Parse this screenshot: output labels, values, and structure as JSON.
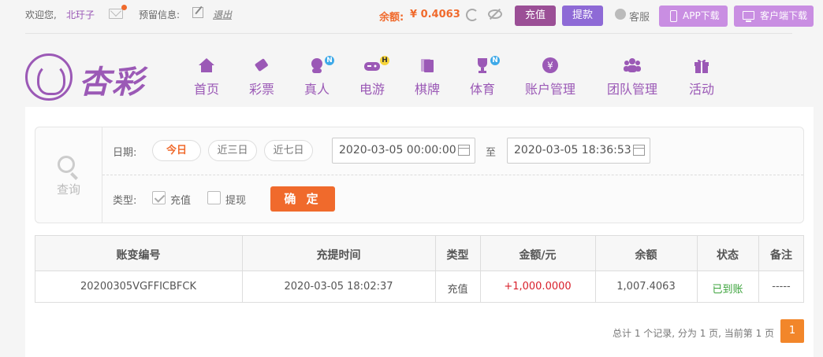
{
  "header": {
    "welcome": "欢迎您,",
    "username": "北玗子",
    "reserved_info_label": "预留信息:",
    "logout": "退出",
    "balance_label": "余额:",
    "balance_value": "¥ 0.4063",
    "recharge_label": "充值",
    "withdraw_label": "提款",
    "service_label": "客服",
    "app_download": "APP下载",
    "client_download": "客户端下载"
  },
  "logo": {
    "text": "杏彩"
  },
  "nav": {
    "items": [
      {
        "label": "首页",
        "icon": "home-icon",
        "badge": ""
      },
      {
        "label": "彩票",
        "icon": "lottery-ticket-icon",
        "badge": ""
      },
      {
        "label": "真人",
        "icon": "live-dealer-icon",
        "badge": "N"
      },
      {
        "label": "电游",
        "icon": "gamepad-icon",
        "badge": "H"
      },
      {
        "label": "棋牌",
        "icon": "cards-icon",
        "badge": ""
      },
      {
        "label": "体育",
        "icon": "trophy-icon",
        "badge": "N"
      },
      {
        "label": "账户管理",
        "icon": "account-yen-icon",
        "badge": ""
      },
      {
        "label": "团队管理",
        "icon": "team-icon",
        "badge": ""
      },
      {
        "label": "活动",
        "icon": "gift-icon",
        "badge": ""
      }
    ]
  },
  "filter": {
    "query_label": "查询",
    "date_label": "日期:",
    "quick_dates": [
      {
        "label": "今日",
        "active": true
      },
      {
        "label": "近三日",
        "active": false
      },
      {
        "label": "近七日",
        "active": false
      }
    ],
    "start_date": "2020-03-05 00:00:00",
    "to_label": "至",
    "end_date": "2020-03-05 18:36:53",
    "type_label": "类型:",
    "types": [
      {
        "label": "充值",
        "checked": true
      },
      {
        "label": "提现",
        "checked": false
      }
    ],
    "confirm_label": "确 定"
  },
  "table": {
    "headers": [
      "账变编号",
      "充提时间",
      "类型",
      "金额/元",
      "余额",
      "状态",
      "备注"
    ],
    "rows": [
      [
        "20200305VGFFICBFCK",
        "2020-03-05 18:02:37",
        "充值",
        "+1,000.0000",
        "1,007.4063",
        "已到账",
        "-----"
      ]
    ]
  },
  "pager": {
    "summary": "总计 1 个记录, 分为 1 页, 当前第 1 页",
    "current_page": "1"
  },
  "colors": {
    "brand_purple": "#9b59b6",
    "accent_orange": "#f06a2c",
    "amount_red": "#d8202b",
    "status_green": "#3ba33b"
  }
}
